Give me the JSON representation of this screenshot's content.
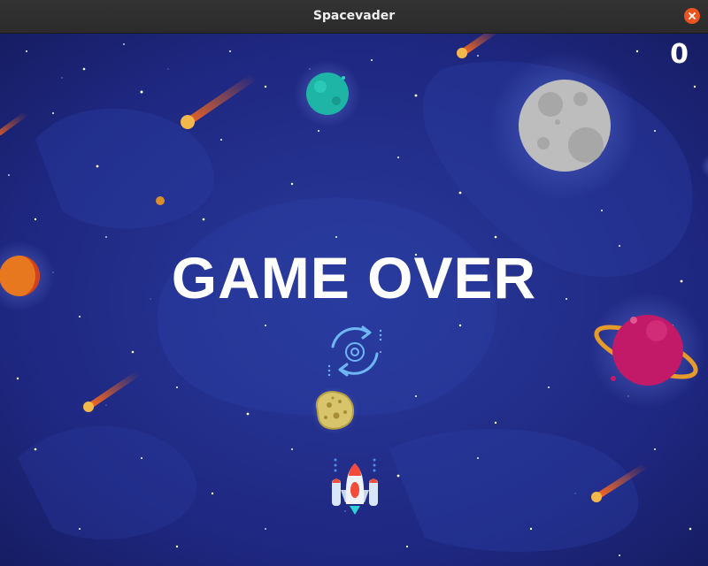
{
  "window": {
    "title": "Spacevader"
  },
  "hud": {
    "score": "0"
  },
  "overlay": {
    "message": "GAME OVER"
  },
  "icons": {
    "close": "close-icon",
    "restart": "restart-icon",
    "player": "spaceship-icon",
    "asteroid": "asteroid-icon"
  },
  "colors": {
    "background_deep": "#1b1f6e",
    "background_mid": "#24318f",
    "titlebar": "#2d2d2d",
    "close_button": "#e95420",
    "score_text": "#ffffff",
    "restart_icon": "#6fb6f5"
  }
}
